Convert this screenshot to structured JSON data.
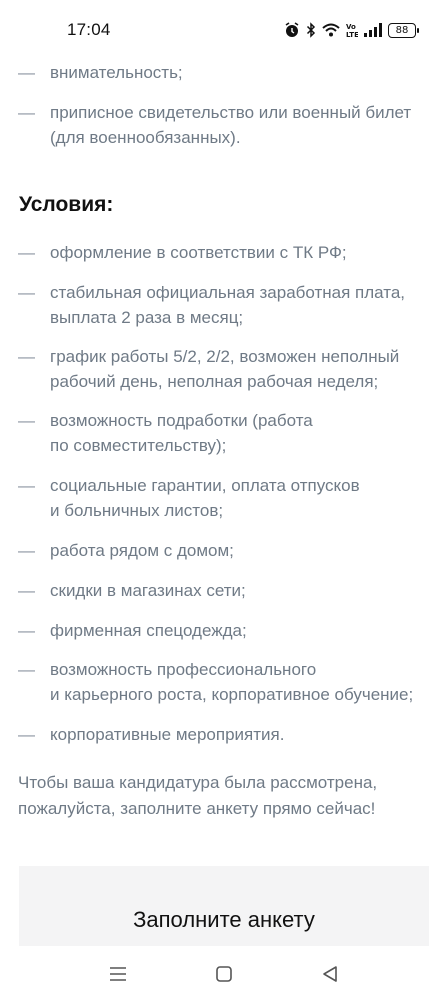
{
  "status_bar": {
    "time": "17:04",
    "battery": "88",
    "icons": [
      "alarm-icon",
      "bluetooth-icon",
      "wifi-icon",
      "volte-icon",
      "signal-icon",
      "battery-icon"
    ]
  },
  "requirements_tail": [
    "внимательность;",
    "приписное свидетельство или военный билет\n(для военнообязанных)."
  ],
  "conditions": {
    "title": "Условия:",
    "items": [
      "оформление в соответствии с ТК РФ;",
      "стабильная официальная заработная плата,\nвыплата 2 раза в месяц;",
      "график работы 5/2, 2/2, возможен неполный\nрабочий день, неполная рабочая неделя;",
      "возможность подработки (работа\nпо совместительству);",
      "социальные гарантии, оплата отпусков\nи больничных листов;",
      "работа рядом с домом;",
      "скидки в магазинах сети;",
      "фирменная спецодежда;",
      "возможность профессионального\nи карьерного роста, корпоративное обучение;",
      "корпоративные мероприятия."
    ]
  },
  "dash": "—",
  "call_to_action": "Чтобы ваша кандидатура была рассмотрена,\nпожалуйста, заполните анкету прямо сейчас!",
  "form_button_label": "Заполните анкету",
  "nav_bar": {
    "icons": [
      "menu-icon",
      "home-icon",
      "back-icon"
    ]
  }
}
